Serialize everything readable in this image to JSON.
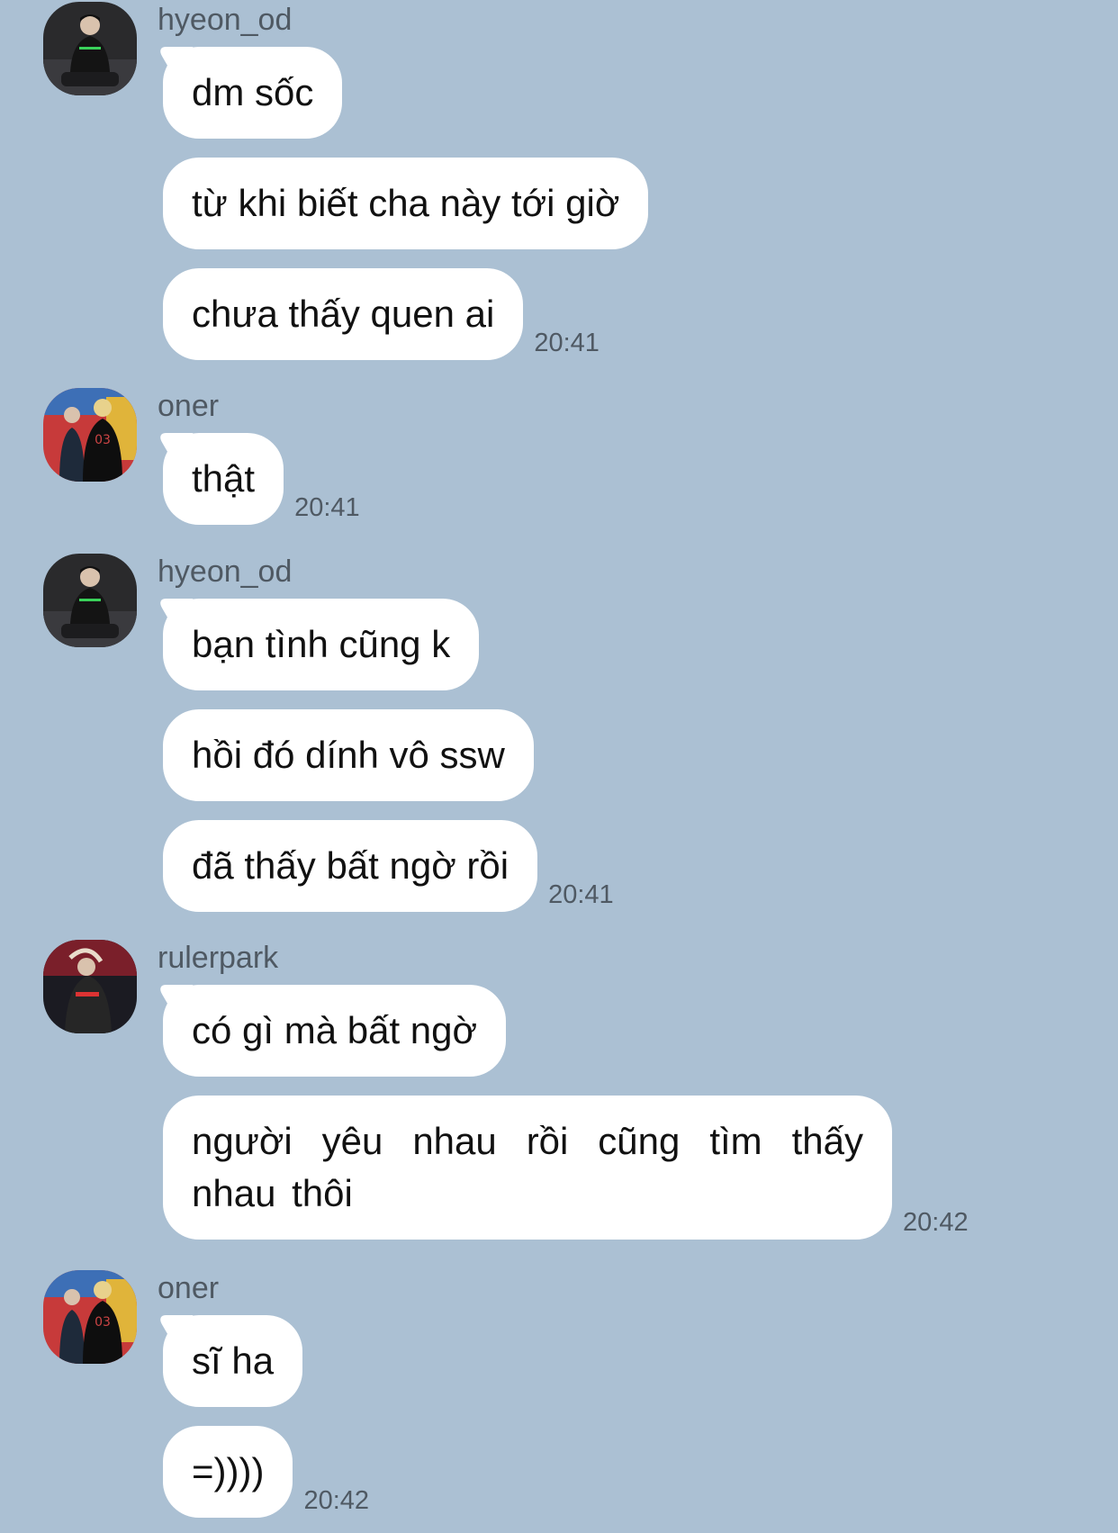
{
  "messages": [
    {
      "sender": "hyeon_od",
      "avatar": "avatar-hyeon",
      "bubbles": [
        "dm sốc",
        "từ khi biết cha này tới giờ",
        "chưa thấy quen ai"
      ],
      "time": "20:41"
    },
    {
      "sender": "oner",
      "avatar": "avatar-oner",
      "bubbles": [
        "thật"
      ],
      "time": "20:41"
    },
    {
      "sender": "hyeon_od",
      "avatar": "avatar-hyeon",
      "bubbles": [
        "bạn tình cũng k",
        "hồi đó dính vô ssw",
        "đã thấy bất ngờ rồi"
      ],
      "time": "20:41"
    },
    {
      "sender": "rulerpark",
      "avatar": "avatar-ruler",
      "bubbles": [
        "có gì mà bất ngờ",
        "người yêu nhau rồi cũng tìm thấy nhau thôi"
      ],
      "time": "20:42"
    },
    {
      "sender": "oner",
      "avatar": "avatar-oner",
      "bubbles": [
        "sĩ ha",
        "=))))"
      ],
      "time": "20:42"
    }
  ],
  "colors": {
    "background": "#abc0d3",
    "bubble": "#ffffff",
    "meta_text": "#4f5963"
  }
}
